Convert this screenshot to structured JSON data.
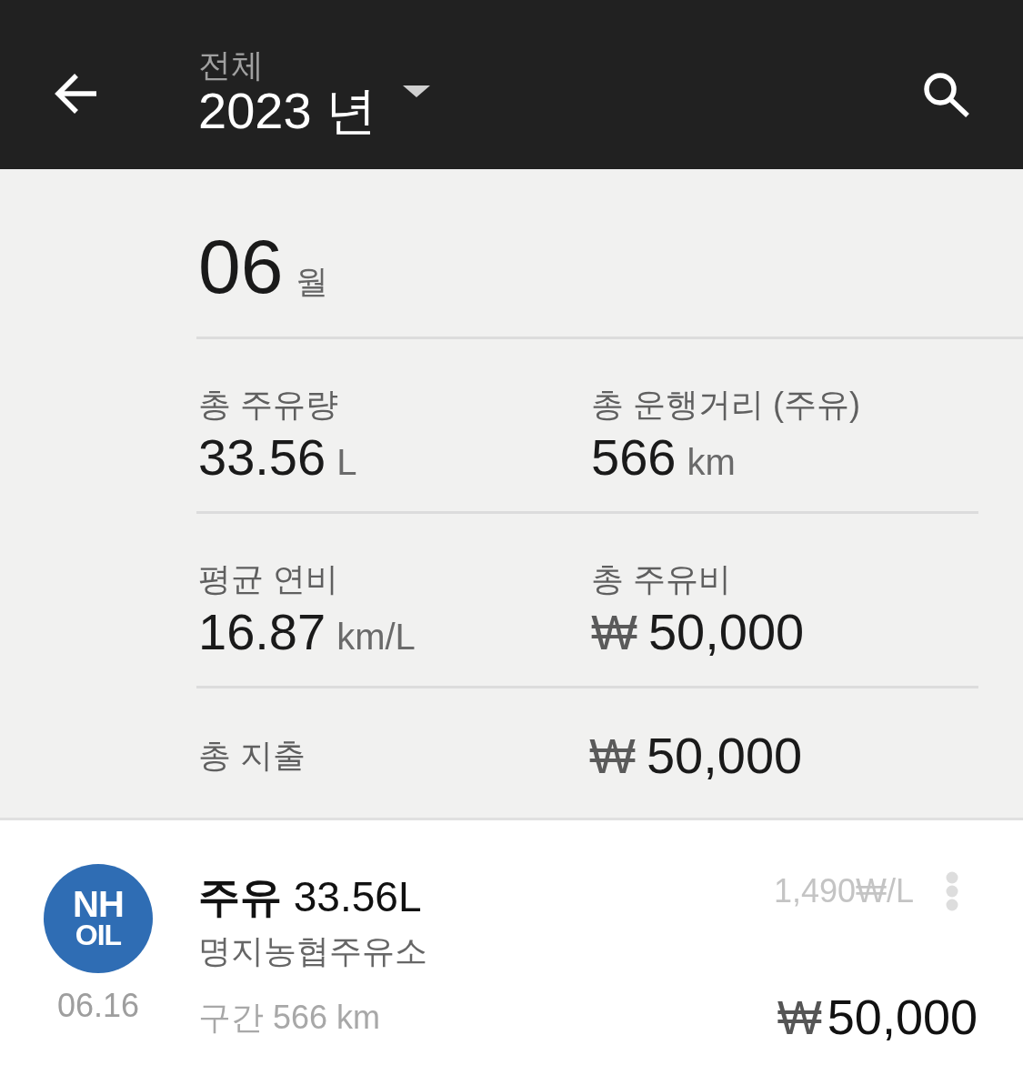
{
  "header": {
    "filter_label": "전체",
    "year": "2023 년"
  },
  "summary": {
    "month": "06",
    "month_unit": "월",
    "stats": [
      {
        "label": "총 주유량",
        "value": "33.56",
        "unit": "L"
      },
      {
        "label": "총 운행거리 (주유)",
        "value": "566",
        "unit": "km"
      },
      {
        "label": "평균 연비",
        "value": "16.87",
        "unit": "km/L"
      },
      {
        "label": "총 주유비",
        "currency": "₩",
        "value": "50,000"
      }
    ],
    "total": {
      "label": "총 지출",
      "currency": "₩",
      "value": "50,000"
    }
  },
  "entries": [
    {
      "logo_lines": [
        "NH",
        "OIL"
      ],
      "date": "06.16",
      "title": "**주유** 33.56L",
      "station": "명지농협주유소",
      "distance": "구간 566 km",
      "unit_price": "1,490₩/L",
      "currency": "₩",
      "amount": "50,000"
    }
  ]
}
